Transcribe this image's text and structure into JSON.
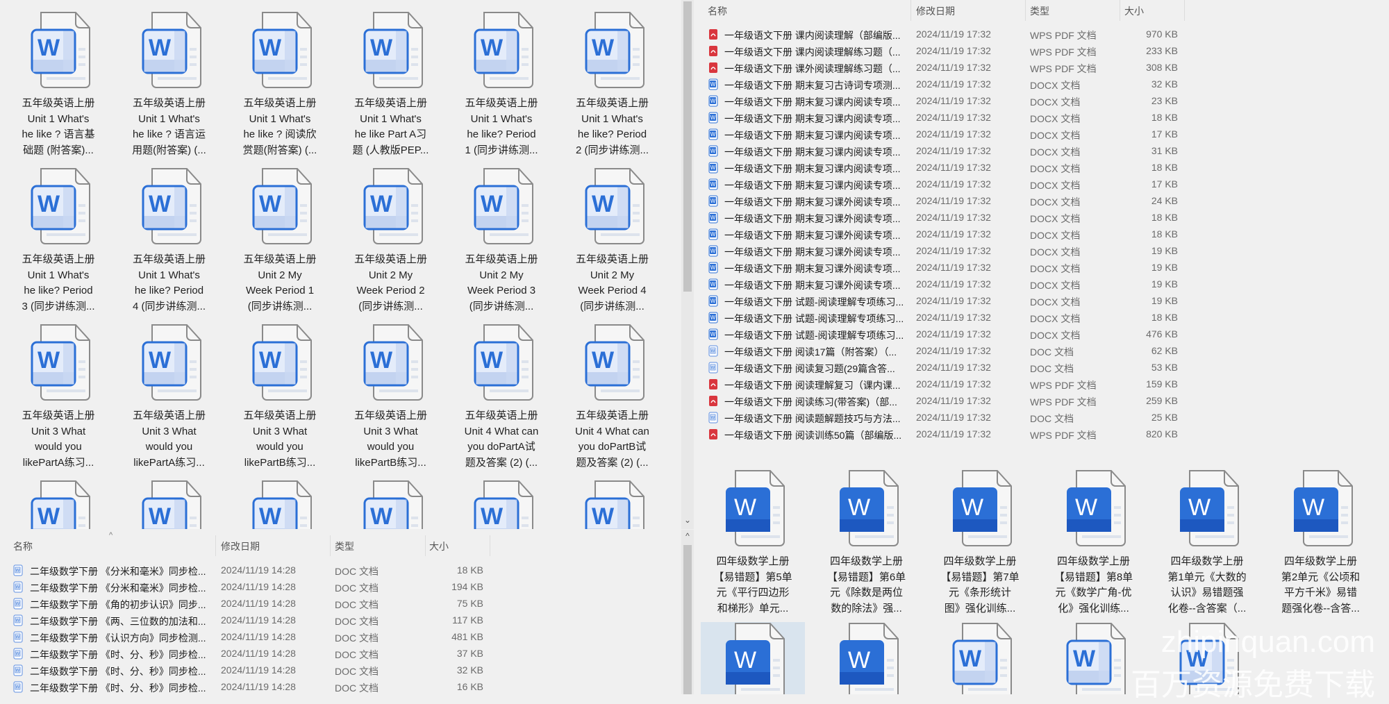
{
  "top_left_grid": {
    "items": [
      {
        "name": "五年级英语上册\nUnit 1 What's\nhe like ? 语言基\n础题 (附答案)..."
      },
      {
        "name": "五年级英语上册\nUnit 1 What's\nhe like ? 语言运\n用题(附答案) (..."
      },
      {
        "name": "五年级英语上册\nUnit 1 What's\nhe like ? 阅读欣\n赏题(附答案) (..."
      },
      {
        "name": "五年级英语上册\nUnit 1 What's\nhe like Part A习\n题 (人教版PEP..."
      },
      {
        "name": "五年级英语上册\nUnit 1 What's\nhe like?  Period\n1 (同步讲练测..."
      },
      {
        "name": "五年级英语上册\nUnit 1 What's\nhe like?  Period\n2 (同步讲练测..."
      },
      {
        "name": "五年级英语上册\nUnit 1 What's\nhe like?  Period\n3 (同步讲练测..."
      },
      {
        "name": "五年级英语上册\nUnit 1 What's\nhe like?  Period\n4 (同步讲练测..."
      },
      {
        "name": "五年级英语上册\nUnit 2  My\nWeek Period 1\n(同步讲练测..."
      },
      {
        "name": "五年级英语上册\nUnit 2  My\nWeek Period 2\n(同步讲练测..."
      },
      {
        "name": "五年级英语上册\nUnit 2  My\nWeek Period 3\n(同步讲练测..."
      },
      {
        "name": "五年级英语上册\nUnit 2  My\nWeek Period 4\n(同步讲练测..."
      },
      {
        "name": "五年级英语上册\nUnit 3 What\nwould you\nlikePartA练习..."
      },
      {
        "name": "五年级英语上册\nUnit 3 What\nwould you\nlikePartA练习..."
      },
      {
        "name": "五年级英语上册\nUnit 3 What\nwould you\nlikePartB练习..."
      },
      {
        "name": "五年级英语上册\nUnit 3 What\nwould you\nlikePartB练习..."
      },
      {
        "name": "五年级英语上册\nUnit 4 What can\nyou doPartA试\n题及答案 (2) (..."
      },
      {
        "name": "五年级英语上册\nUnit 4 What can\nyou doPartB试\n题及答案 (2) (..."
      }
    ]
  },
  "columns": {
    "name": "名称",
    "date": "修改日期",
    "type": "类型",
    "size": "大小"
  },
  "bottom_left_list": {
    "rows": [
      {
        "icon": "doc",
        "name": "二年级数学下册  《分米和毫米》同步检...",
        "date": "2024/11/19 14:28",
        "type": "DOC 文档",
        "size": "18 KB"
      },
      {
        "icon": "doc",
        "name": "二年级数学下册  《分米和毫米》同步检...",
        "date": "2024/11/19 14:28",
        "type": "DOC 文档",
        "size": "194 KB"
      },
      {
        "icon": "doc",
        "name": "二年级数学下册  《角的初步认识》同步...",
        "date": "2024/11/19 14:28",
        "type": "DOC 文档",
        "size": "75 KB"
      },
      {
        "icon": "doc",
        "name": "二年级数学下册  《两、三位数的加法和...",
        "date": "2024/11/19 14:28",
        "type": "DOC 文档",
        "size": "117 KB"
      },
      {
        "icon": "doc",
        "name": "二年级数学下册  《认识方向》同步检测...",
        "date": "2024/11/19 14:28",
        "type": "DOC 文档",
        "size": "481 KB"
      },
      {
        "icon": "doc",
        "name": "二年级数学下册  《时、分、秒》同步检...",
        "date": "2024/11/19 14:28",
        "type": "DOC 文档",
        "size": "37 KB"
      },
      {
        "icon": "doc",
        "name": "二年级数学下册  《时、分、秒》同步检...",
        "date": "2024/11/19 14:28",
        "type": "DOC 文档",
        "size": "32 KB"
      },
      {
        "icon": "doc",
        "name": "二年级数学下册  《时、分、秒》同步检...",
        "date": "2024/11/19 14:28",
        "type": "DOC 文档",
        "size": "16 KB"
      }
    ]
  },
  "top_right_list": {
    "rows": [
      {
        "icon": "pdf",
        "name": "一年级语文下册  课内阅读理解（部编版...",
        "date": "2024/11/19 17:32",
        "type": "WPS PDF 文档",
        "size": "970 KB"
      },
      {
        "icon": "pdf",
        "name": "一年级语文下册  课内阅读理解练习题（...",
        "date": "2024/11/19 17:32",
        "type": "WPS PDF 文档",
        "size": "233 KB"
      },
      {
        "icon": "pdf",
        "name": "一年级语文下册  课外阅读理解练习题（...",
        "date": "2024/11/19 17:32",
        "type": "WPS PDF 文档",
        "size": "308 KB"
      },
      {
        "icon": "docx",
        "name": "一年级语文下册  期末复习古诗词专项测...",
        "date": "2024/11/19 17:32",
        "type": "DOCX 文档",
        "size": "32 KB"
      },
      {
        "icon": "docx",
        "name": "一年级语文下册  期末复习课内阅读专项...",
        "date": "2024/11/19 17:32",
        "type": "DOCX 文档",
        "size": "23 KB"
      },
      {
        "icon": "docx",
        "name": "一年级语文下册  期末复习课内阅读专项...",
        "date": "2024/11/19 17:32",
        "type": "DOCX 文档",
        "size": "18 KB"
      },
      {
        "icon": "docx",
        "name": "一年级语文下册  期末复习课内阅读专项...",
        "date": "2024/11/19 17:32",
        "type": "DOCX 文档",
        "size": "17 KB"
      },
      {
        "icon": "docx",
        "name": "一年级语文下册  期末复习课内阅读专项...",
        "date": "2024/11/19 17:32",
        "type": "DOCX 文档",
        "size": "31 KB"
      },
      {
        "icon": "docx",
        "name": "一年级语文下册  期末复习课内阅读专项...",
        "date": "2024/11/19 17:32",
        "type": "DOCX 文档",
        "size": "18 KB"
      },
      {
        "icon": "docx",
        "name": "一年级语文下册  期末复习课内阅读专项...",
        "date": "2024/11/19 17:32",
        "type": "DOCX 文档",
        "size": "17 KB"
      },
      {
        "icon": "docx",
        "name": "一年级语文下册  期末复习课外阅读专项...",
        "date": "2024/11/19 17:32",
        "type": "DOCX 文档",
        "size": "24 KB"
      },
      {
        "icon": "docx",
        "name": "一年级语文下册  期末复习课外阅读专项...",
        "date": "2024/11/19 17:32",
        "type": "DOCX 文档",
        "size": "18 KB"
      },
      {
        "icon": "docx",
        "name": "一年级语文下册  期末复习课外阅读专项...",
        "date": "2024/11/19 17:32",
        "type": "DOCX 文档",
        "size": "18 KB"
      },
      {
        "icon": "docx",
        "name": "一年级语文下册  期末复习课外阅读专项...",
        "date": "2024/11/19 17:32",
        "type": "DOCX 文档",
        "size": "19 KB"
      },
      {
        "icon": "docx",
        "name": "一年级语文下册  期末复习课外阅读专项...",
        "date": "2024/11/19 17:32",
        "type": "DOCX 文档",
        "size": "19 KB"
      },
      {
        "icon": "docx",
        "name": "一年级语文下册  期末复习课外阅读专项...",
        "date": "2024/11/19 17:32",
        "type": "DOCX 文档",
        "size": "19 KB"
      },
      {
        "icon": "docx",
        "name": "一年级语文下册  试题-阅读理解专项练习...",
        "date": "2024/11/19 17:32",
        "type": "DOCX 文档",
        "size": "19 KB"
      },
      {
        "icon": "docx",
        "name": "一年级语文下册  试题-阅读理解专项练习...",
        "date": "2024/11/19 17:32",
        "type": "DOCX 文档",
        "size": "18 KB"
      },
      {
        "icon": "docx",
        "name": "一年级语文下册  试题-阅读理解专项练习...",
        "date": "2024/11/19 17:32",
        "type": "DOCX 文档",
        "size": "476 KB"
      },
      {
        "icon": "doc",
        "name": "一年级语文下册  阅读17篇（附答案）（...",
        "date": "2024/11/19 17:32",
        "type": "DOC 文档",
        "size": "62 KB"
      },
      {
        "icon": "doc",
        "name": "一年级语文下册  阅读复习题(29篇含答...",
        "date": "2024/11/19 17:32",
        "type": "DOC 文档",
        "size": "53 KB"
      },
      {
        "icon": "pdf",
        "name": "一年级语文下册  阅读理解复习（课内课...",
        "date": "2024/11/19 17:32",
        "type": "WPS PDF 文档",
        "size": "159 KB"
      },
      {
        "icon": "pdf",
        "name": "一年级语文下册  阅读练习(带答案)（部...",
        "date": "2024/11/19 17:32",
        "type": "WPS PDF 文档",
        "size": "259 KB"
      },
      {
        "icon": "doc",
        "name": "一年级语文下册  阅读题解题技巧与方法...",
        "date": "2024/11/19 17:32",
        "type": "DOC 文档",
        "size": "25 KB"
      },
      {
        "icon": "pdf",
        "name": "一年级语文下册  阅读训练50篇（部编版...",
        "date": "2024/11/19 17:32",
        "type": "WPS PDF 文档",
        "size": "820 KB"
      }
    ]
  },
  "bottom_right_grid": {
    "items": [
      {
        "name": "四年级数学上册\n【易错题】第5单\n元《平行四边形\n和梯形》单元..."
      },
      {
        "name": "四年级数学上册\n【易错题】第6单\n元《除数是两位\n数的除法》强..."
      },
      {
        "name": "四年级数学上册\n【易错题】第7单\n元《条形统计\n图》强化训练..."
      },
      {
        "name": "四年级数学上册\n【易错题】第8单\n元《数学广角-优\n化》强化训练..."
      },
      {
        "name": "四年级数学上册\n第1单元《大数的\n认识》易错题强\n化卷--含答案（..."
      },
      {
        "name": "四年级数学上册\n第2单元《公顷和\n平方千米》易错\n题强化卷--含答..."
      }
    ],
    "second_row_styles": [
      "solid",
      "solid",
      "outline",
      "outline",
      "outline"
    ]
  },
  "watermark": {
    "line1": "zhipinquan.com",
    "line2": "百万资源免费下载"
  },
  "colors": {
    "word_blue": "#2b6fd6",
    "pdf_red": "#d9363e",
    "bg": "#f0f0f0"
  }
}
